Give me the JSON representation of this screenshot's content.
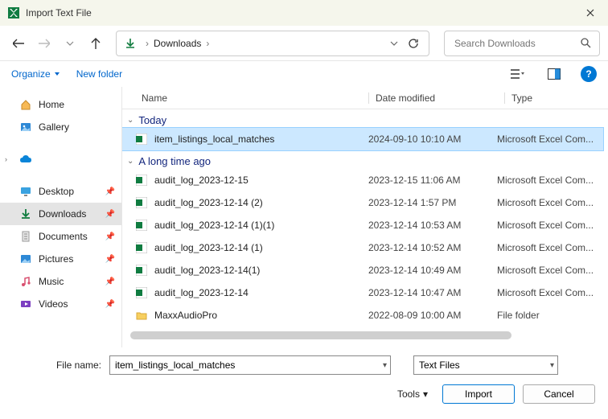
{
  "window": {
    "title": "Import Text File"
  },
  "breadcrumb": {
    "location": "Downloads",
    "sep": "›"
  },
  "search": {
    "placeholder": "Search Downloads"
  },
  "toolbar": {
    "organize": "Organize",
    "newfolder": "New folder"
  },
  "columns": {
    "name": "Name",
    "date": "Date modified",
    "type": "Type"
  },
  "sidebar": {
    "home": "Home",
    "gallery": "Gallery",
    "desktop": "Desktop",
    "downloads": "Downloads",
    "documents": "Documents",
    "pictures": "Pictures",
    "music": "Music",
    "videos": "Videos"
  },
  "groups": {
    "g0": "Today",
    "g1": "A long time ago"
  },
  "files": {
    "f0": {
      "name": "item_listings_local_matches",
      "date": "2024-09-10 10:10 AM",
      "type": "Microsoft Excel Com..."
    },
    "f1": {
      "name": "audit_log_2023-12-15",
      "date": "2023-12-15 11:06 AM",
      "type": "Microsoft Excel Com..."
    },
    "f2": {
      "name": "audit_log_2023-12-14 (2)",
      "date": "2023-12-14 1:57 PM",
      "type": "Microsoft Excel Com..."
    },
    "f3": {
      "name": "audit_log_2023-12-14 (1)(1)",
      "date": "2023-12-14 10:53 AM",
      "type": "Microsoft Excel Com..."
    },
    "f4": {
      "name": "audit_log_2023-12-14 (1)",
      "date": "2023-12-14 10:52 AM",
      "type": "Microsoft Excel Com..."
    },
    "f5": {
      "name": "audit_log_2023-12-14(1)",
      "date": "2023-12-14 10:49 AM",
      "type": "Microsoft Excel Com..."
    },
    "f6": {
      "name": "audit_log_2023-12-14",
      "date": "2023-12-14 10:47 AM",
      "type": "Microsoft Excel Com..."
    },
    "f7": {
      "name": "MaxxAudioPro",
      "date": "2022-08-09 10:00 AM",
      "type": "File folder"
    }
  },
  "footer": {
    "filename_label": "File name:",
    "filename_value": "item_listings_local_matches",
    "filter_value": "Text Files",
    "tools": "Tools",
    "import": "Import",
    "cancel": "Cancel"
  }
}
